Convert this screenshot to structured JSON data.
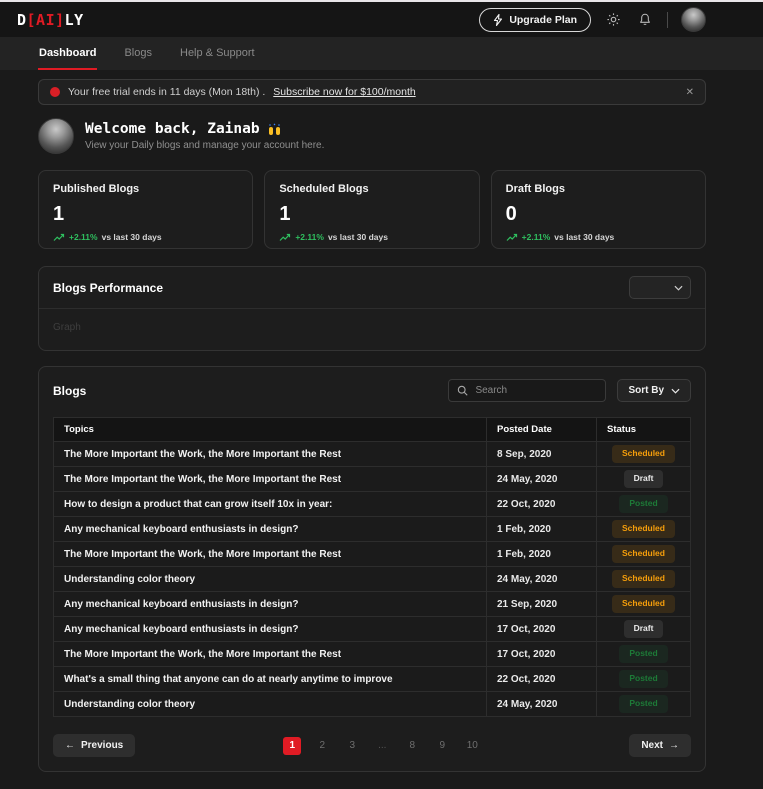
{
  "header": {
    "logo_d": "D",
    "logo_ai": "[AI]",
    "logo_ly": "LY",
    "upgrade_label": "Upgrade Plan"
  },
  "nav": {
    "tabs": [
      {
        "label": "Dashboard",
        "cls": "active"
      },
      {
        "label": "Blogs"
      },
      {
        "label": "Help & Support"
      }
    ]
  },
  "banner": {
    "message": "Your free trial ends in 11 days (Mon 18th) .",
    "link": "Subscribe now for $100/month",
    "close": "✕"
  },
  "welcome": {
    "title": "Welcome back, Zainab",
    "subtitle": "View your Daily blogs and manage your account here."
  },
  "stats": [
    {
      "label": "Published Blogs",
      "value": "1",
      "trend": "+2.11%",
      "note": "vs last 30 days"
    },
    {
      "label": "Scheduled Blogs",
      "value": "1",
      "trend": "+2.11%",
      "note": "vs last 30 days"
    },
    {
      "label": "Draft Blogs",
      "value": "0",
      "trend": "+2.11%",
      "note": "vs last 30 days"
    }
  ],
  "performance": {
    "title": "Blogs Performance",
    "select_value": "",
    "placeholder": "Graph"
  },
  "blogs": {
    "title": "Blogs",
    "search_placeholder": "Search",
    "sort_label": "Sort By",
    "headers": {
      "topic": "Topics",
      "date": "Posted Date",
      "status": "Status"
    },
    "rows": [
      {
        "topic": "The More Important the Work, the More Important the Rest",
        "date": "8 Sep, 2020",
        "status": "Scheduled"
      },
      {
        "topic": "The More Important the Work, the More Important the Rest",
        "date": "24 May, 2020",
        "status": "Draft"
      },
      {
        "topic": "How to design a product that can grow itself 10x in year:",
        "date": "22 Oct, 2020",
        "status": "Posted"
      },
      {
        "topic": "Any mechanical keyboard enthusiasts in design?",
        "date": "1 Feb, 2020",
        "status": "Scheduled"
      },
      {
        "topic": "The More Important the Work, the More Important the Rest",
        "date": "1 Feb, 2020",
        "status": "Scheduled"
      },
      {
        "topic": "Understanding color theory",
        "date": "24 May, 2020",
        "status": "Scheduled"
      },
      {
        "topic": "Any mechanical keyboard enthusiasts in design?",
        "date": "21 Sep, 2020",
        "status": "Scheduled"
      },
      {
        "topic": "Any mechanical keyboard enthusiasts in design?",
        "date": "17 Oct, 2020",
        "status": "Draft"
      },
      {
        "topic": "The More Important the Work, the More Important the Rest",
        "date": "17 Oct, 2020",
        "status": "Posted"
      },
      {
        "topic": "What's a small thing that anyone can do at nearly anytime to improve",
        "date": "22 Oct, 2020",
        "status": "Posted"
      },
      {
        "topic": "Understanding color theory",
        "date": "24 May, 2020",
        "status": "Posted"
      }
    ],
    "pagination": {
      "prev": "Previous",
      "prev_arrow": "←",
      "next": "Next",
      "next_arrow": "→",
      "pages": [
        {
          "label": "1",
          "cls": "active"
        },
        {
          "label": "2"
        },
        {
          "label": "3"
        },
        {
          "label": "...",
          "cls": "ellipsis"
        },
        {
          "label": "8"
        },
        {
          "label": "9"
        },
        {
          "label": "10"
        }
      ]
    }
  },
  "colors": {
    "accent_red": "#e01b24",
    "trend_green": "#2fbf5f",
    "scheduled": "#f59e0b",
    "posted": "#1d7a37",
    "draft": "#ececec"
  }
}
